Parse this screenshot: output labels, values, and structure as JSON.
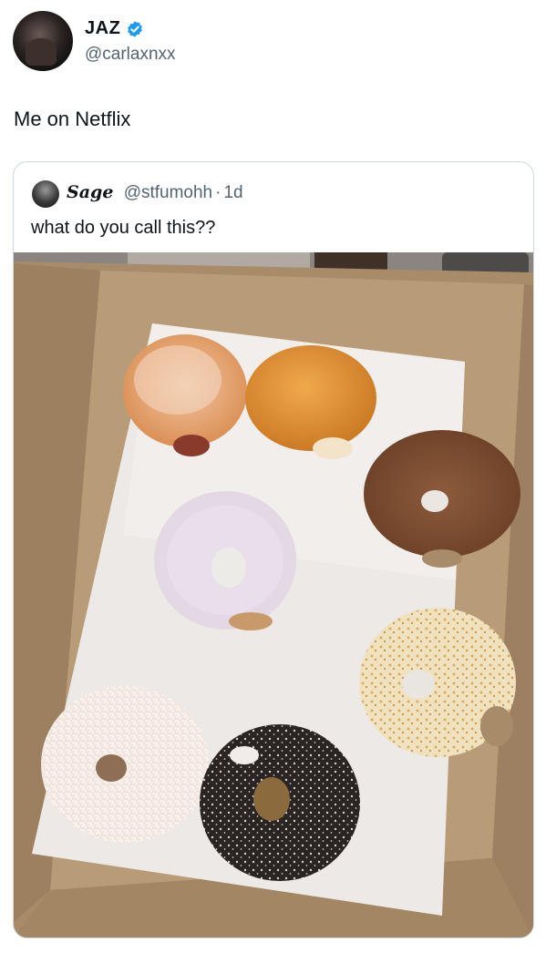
{
  "author": {
    "name": "JAZ",
    "handle": "@carlaxnxx",
    "verified": true,
    "avatar_icon": "user-avatar"
  },
  "tweet": {
    "text": "Me on Netflix"
  },
  "quoted": {
    "name": "Sage",
    "handle": "@stfumohh",
    "separator": "·",
    "time": "1d",
    "text": "what do you call this??",
    "photo_description": "box of half-eaten donuts"
  },
  "colors": {
    "verified": "#1d9bf0",
    "secondary_text": "#536471",
    "border": "#cfd9de",
    "box": "#b79a76"
  }
}
